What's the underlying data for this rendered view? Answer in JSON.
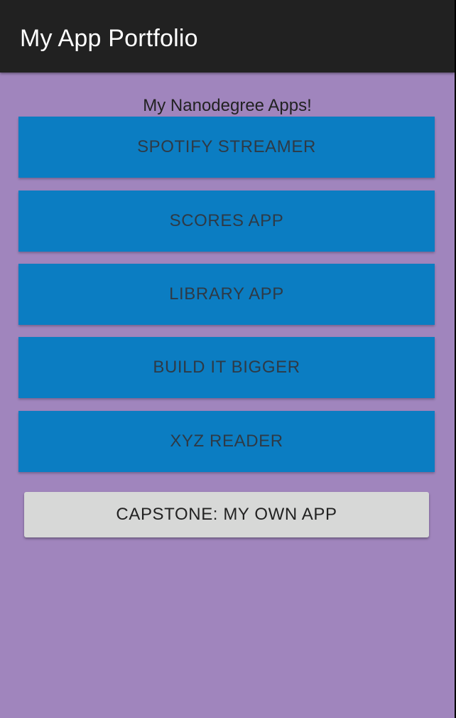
{
  "app_bar": {
    "title": "My App Portfolio"
  },
  "main": {
    "subtitle": "My Nanodegree Apps!",
    "app_buttons": [
      {
        "label": "SPOTIFY STREAMER"
      },
      {
        "label": "SCORES APP"
      },
      {
        "label": "LIBRARY APP"
      },
      {
        "label": "BUILD IT BIGGER"
      },
      {
        "label": "XYZ READER"
      }
    ],
    "capstone_button": {
      "label": "CAPSTONE: MY OWN APP"
    }
  },
  "colors": {
    "background": "#A085BD",
    "app_bar": "#212121",
    "app_button": "#0B7DC2",
    "capstone_button": "#D7D8D7"
  }
}
